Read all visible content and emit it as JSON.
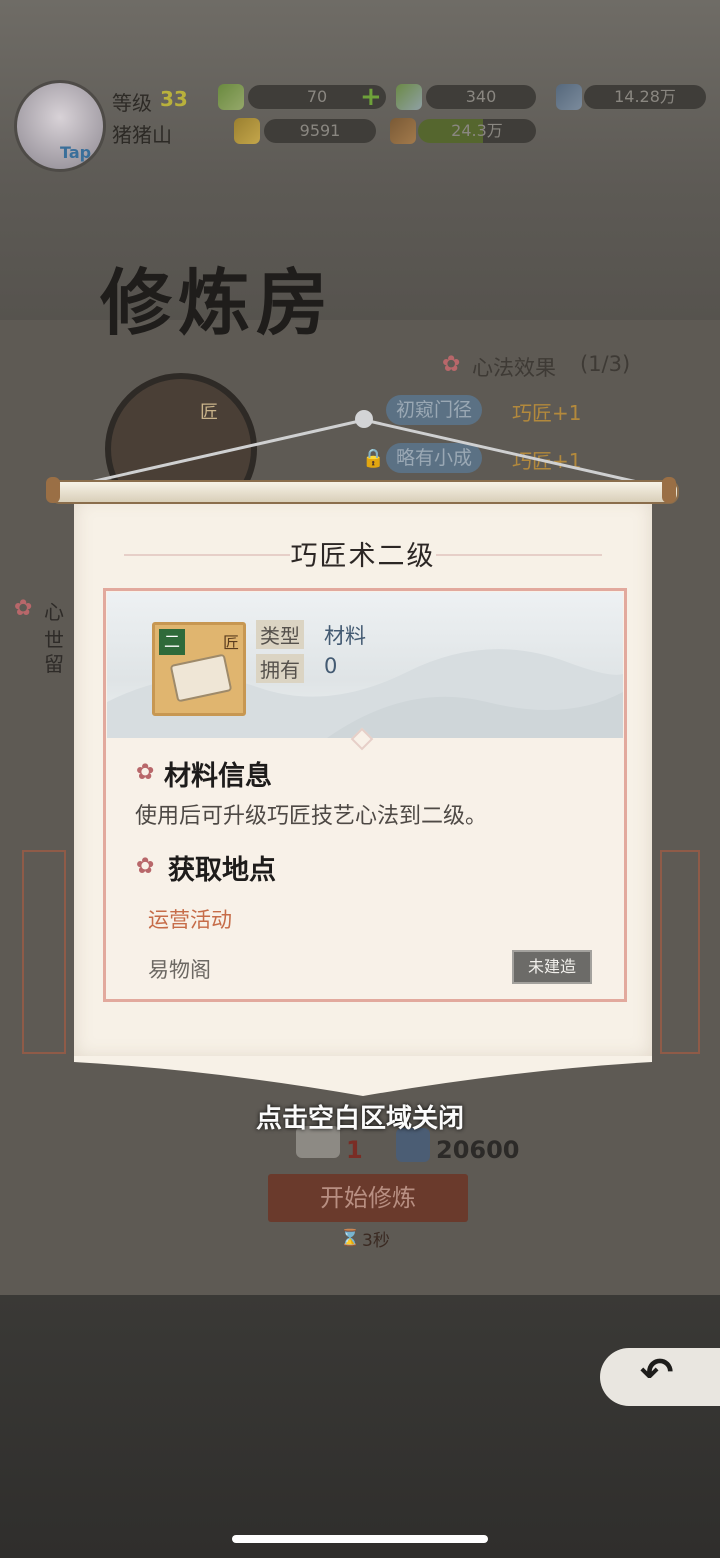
{
  "header": {
    "avatar_tag": "Tap",
    "level_label": "等级",
    "level": "33",
    "player_name": "猪猪山",
    "resources": [
      {
        "icon": "green-crystal-icon",
        "value": "70",
        "has_add": true,
        "add_label": "+"
      },
      {
        "icon": "blue-crystal-icon",
        "value": "340"
      },
      {
        "icon": "ore-icon",
        "value": "14.28万"
      },
      {
        "icon": "gold-ingot-icon",
        "value": "9591"
      },
      {
        "icon": "food-icon",
        "value": "24.3万"
      }
    ]
  },
  "page_title": "修炼房",
  "background": {
    "effects_title": "心法效果",
    "effects_count": "(1/3)",
    "effects": [
      {
        "level": "初窥门径",
        "bonus": "巧匠+1",
        "locked": false
      },
      {
        "level": "略有小成",
        "bonus": "巧匠+1",
        "locked": true
      }
    ],
    "medal_char": "匠",
    "side_lines": [
      "心",
      "世",
      "留"
    ],
    "cost_scroll": "1",
    "cost_ore": "20600",
    "start_button": "开始修炼",
    "timer": "3秒"
  },
  "dialog": {
    "title": "巧匠术二级",
    "item_corner_grade": "二",
    "item_corner_char": "匠",
    "type_label": "类型",
    "type_value": "材料",
    "own_label": "拥有",
    "own_value": "0",
    "info_title": "材料信息",
    "info_desc": "使用后可升级巧匠技艺心法到二级。",
    "source_title": "获取地点",
    "sources": [
      {
        "name": "运营活动",
        "status": ""
      },
      {
        "name": "易物阁",
        "status": "未建造"
      }
    ]
  },
  "close_hint": "点击空白区域关闭",
  "colors": {
    "accent_red": "#c66c48",
    "title_dark": "#1f1d1b",
    "frame_pink": "#e2a99d"
  }
}
